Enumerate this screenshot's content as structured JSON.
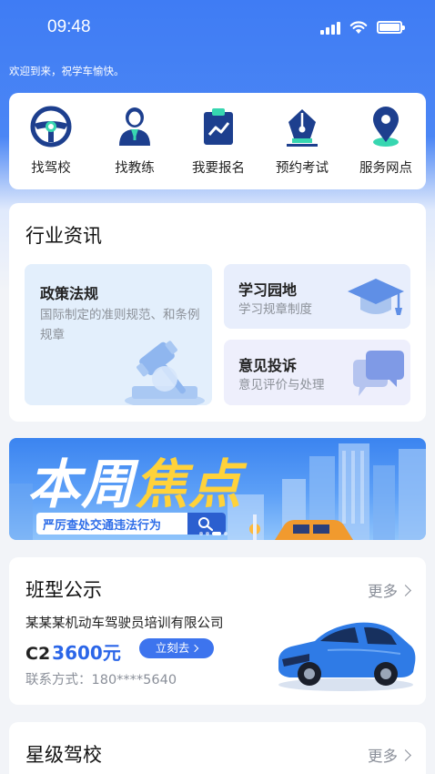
{
  "status_bar": {
    "time": "09:48"
  },
  "welcome_text": "欢迎到来，祝学车愉快。",
  "quick_nav": [
    {
      "label": "找驾校",
      "icon": "steering-wheel-icon"
    },
    {
      "label": "找教练",
      "icon": "coach-person-icon"
    },
    {
      "label": "我要报名",
      "icon": "clipboard-chart-icon"
    },
    {
      "label": "预约考试",
      "icon": "fountain-pen-icon"
    },
    {
      "label": "服务网点",
      "icon": "location-pin-icon"
    }
  ],
  "news": {
    "title": "行业资讯",
    "tiles": [
      {
        "title": "政策法规",
        "subtitle": "国际制定的准则规范、和条例规章",
        "icon": "gavel-icon"
      },
      {
        "title": "学习园地",
        "subtitle": "学习规章制度",
        "icon": "graduation-cap-icon"
      },
      {
        "title": "意见投诉",
        "subtitle": "意见评价与处理",
        "icon": "chat-bubbles-icon"
      }
    ]
  },
  "banner": {
    "title_part1": "本周",
    "title_part2": "焦点",
    "search_text": "严厉查处交通违法行为",
    "search_icon": "search-icon"
  },
  "course": {
    "title": "班型公示",
    "more_label": "更多",
    "company": "某某某机动车驾驶员培训有限公司",
    "license": "C2",
    "price": "3600元",
    "button_label": "立刻去",
    "contact_label": "联系方式：",
    "contact_phone": "180****5640"
  },
  "star_schools": {
    "title": "星级驾校",
    "more_label": "更多"
  },
  "colors": {
    "primary": "#3f7cf4",
    "accent_yellow": "#ffd23a",
    "price_blue": "#2b66e8"
  }
}
